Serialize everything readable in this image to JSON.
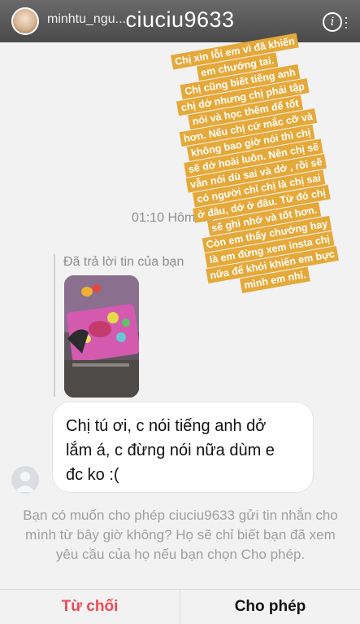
{
  "header": {
    "story_username": "minhtu_ngu...",
    "chat_title": "ciuciu9633",
    "info_icon": "info-icon",
    "info_glyph": "i"
  },
  "story_note": {
    "background": "#e5a93a",
    "lines": [
      "Chị xin lỗi em vì đã khiến",
      "em chướng tai.",
      "Chị cũng biết tiếng anh",
      "chị dở nhưng chị phải tập",
      "nói và học thêm để tốt",
      "hơn. Nếu chị cứ mắc cỡ và",
      "không bao giờ nói thì chị",
      "sẽ dở hoài luôn. Nên chị sẽ",
      "vẫn nói dù sai và dở , rồi sẽ",
      "có người chỉ chị là chị sai",
      "ở đâu, dở ở đâu. Từ đó chị",
      "sẽ ghi nhớ và tốt hơn.",
      "Còn em thấy chướng hay",
      "là em đừng xem insta chị",
      "nữa để khỏi khiến em bực",
      "mình em nhỉ."
    ]
  },
  "conversation": {
    "timestamp": "01:10 Hôm na",
    "reply_label": "Đã trả lời tin của bạn",
    "message_lines": [
      "Chị tú ơi, c nói tiếng anh dở",
      "lắm á, c đừng nói nữa dùm e",
      "đc ko :("
    ]
  },
  "request": {
    "prompt": "Bạn có muốn cho phép ciuciu9633 gửi tin nhắn cho mình từ bây giờ không? Họ sẽ chỉ biết bạn đã xem yêu cầu của họ nếu bạn chọn Cho phép.",
    "decline_label": "Từ chối",
    "allow_label": "Cho phép",
    "decline_color": "#ed4956"
  }
}
